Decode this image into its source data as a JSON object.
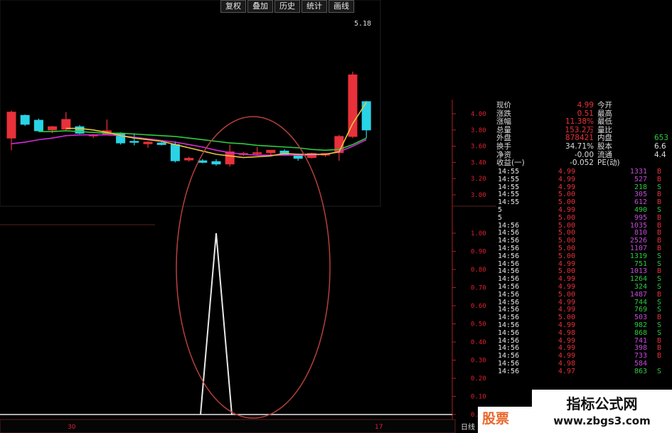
{
  "toolbar": {
    "buttons": [
      "复权",
      "叠加",
      "历史",
      "统计",
      "画线"
    ]
  },
  "price_top": "5.18",
  "price_axis": [
    "4.00",
    "3.80",
    "3.60",
    "3.40",
    "3.20",
    "3.00"
  ],
  "indicator_axis": [
    "1.00",
    "0.90",
    "0.80",
    "0.70",
    "0.60",
    "0.50",
    "0.40",
    "0.30",
    "0.20",
    "0.10",
    "0.00"
  ],
  "bottom_labels": {
    "left": "30",
    "right": "17",
    "corner": "日线"
  },
  "colors": {
    "up": "#e8313a",
    "down": "#29d3e6",
    "ma_green": "#2ecc40",
    "ma_magenta": "#d52bd8",
    "ma_yellow": "#e6c640",
    "ellipse": "#b5403a"
  },
  "quote": [
    {
      "label": "现价",
      "value": "4.99",
      "label2": "今开",
      "value2": ""
    },
    {
      "label": "涨跌",
      "value": "0.51",
      "label2": "最高",
      "value2": ""
    },
    {
      "label": "涨幅",
      "value": "11.38%",
      "label2": "最低",
      "value2": ""
    },
    {
      "label": "总量",
      "value": "153.2万",
      "label2": "量比",
      "value2": ""
    },
    {
      "label": "外盘",
      "value": "878421",
      "label2": "内盘",
      "value2": "653"
    },
    {
      "label": "换手",
      "value": "34.71%",
      "label2": "股本",
      "value2": "6.6"
    },
    {
      "label": "净资",
      "value": "-0.00",
      "label2": "流通",
      "value2": "4.4"
    },
    {
      "label": "收益(一)",
      "value": "-0.052",
      "label2": "PE(动)",
      "value2": ""
    }
  ],
  "trades": [
    [
      "14:55",
      "4.99",
      "1331",
      "B"
    ],
    [
      "14:55",
      "4.99",
      "527",
      "B"
    ],
    [
      "14:55",
      "4.99",
      "218",
      "S"
    ],
    [
      "14:55",
      "5.00",
      "305",
      "B"
    ],
    [
      "14:55",
      "5.00",
      "612",
      "B"
    ],
    [
      "5",
      "4.99",
      "490",
      "S"
    ],
    [
      "5",
      "5.00",
      "995",
      "B"
    ],
    [
      "14:56",
      "5.00",
      "1035",
      "B"
    ],
    [
      "14:56",
      "5.00",
      "810",
      "B"
    ],
    [
      "14:56",
      "5.00",
      "2526",
      "B"
    ],
    [
      "14:56",
      "5.00",
      "1107",
      "B"
    ],
    [
      "14:56",
      "5.00",
      "1319",
      "S"
    ],
    [
      "14:56",
      "4.99",
      "751",
      "S"
    ],
    [
      "14:56",
      "5.00",
      "1013",
      "B"
    ],
    [
      "14:56",
      "4.99",
      "1264",
      "S"
    ],
    [
      "14:56",
      "4.99",
      "324",
      "S"
    ],
    [
      "14:56",
      "5.00",
      "1487",
      "B"
    ],
    [
      "14:56",
      "4.99",
      "744",
      "S"
    ],
    [
      "14:56",
      "4.99",
      "769",
      "S"
    ],
    [
      "14:56",
      "5.00",
      "503",
      "B"
    ],
    [
      "14:56",
      "4.99",
      "982",
      "S"
    ],
    [
      "14:56",
      "4.98",
      "868",
      "S"
    ],
    [
      "14:56",
      "4.99",
      "741",
      "B"
    ],
    [
      "14:56",
      "4.99",
      "398",
      "B"
    ],
    [
      "14:56",
      "4.99",
      "733",
      "B"
    ],
    [
      "14:56",
      "4.98",
      "584",
      ""
    ],
    [
      "14:56",
      "4.97",
      "863",
      "S"
    ]
  ],
  "watermark": {
    "line1": "指标公式网",
    "line2": "www.zbgs3.com",
    "logo": "股票"
  },
  "chart_data": [
    {
      "type": "candlestick",
      "candles": [
        {
          "o": 3.7,
          "h": 4.04,
          "l": 3.55,
          "c": 4.02
        },
        {
          "o": 3.98,
          "h": 3.99,
          "l": 3.85,
          "c": 3.87
        },
        {
          "o": 3.92,
          "h": 3.94,
          "l": 3.78,
          "c": 3.79
        },
        {
          "o": 3.8,
          "h": 3.85,
          "l": 3.76,
          "c": 3.84
        },
        {
          "o": 3.81,
          "h": 4.02,
          "l": 3.79,
          "c": 3.93
        },
        {
          "o": 3.84,
          "h": 3.86,
          "l": 3.75,
          "c": 3.76
        },
        {
          "o": 3.73,
          "h": 3.75,
          "l": 3.7,
          "c": 3.74
        },
        {
          "o": 3.75,
          "h": 3.93,
          "l": 3.74,
          "c": 3.79
        },
        {
          "o": 3.75,
          "h": 3.77,
          "l": 3.62,
          "c": 3.64
        },
        {
          "o": 3.66,
          "h": 3.76,
          "l": 3.61,
          "c": 3.65
        },
        {
          "o": 3.63,
          "h": 3.66,
          "l": 3.58,
          "c": 3.65
        },
        {
          "o": 3.64,
          "h": 3.65,
          "l": 3.61,
          "c": 3.62
        },
        {
          "o": 3.62,
          "h": 3.66,
          "l": 3.4,
          "c": 3.42
        },
        {
          "o": 3.43,
          "h": 3.47,
          "l": 3.41,
          "c": 3.45
        },
        {
          "o": 3.42,
          "h": 3.44,
          "l": 3.39,
          "c": 3.4
        },
        {
          "o": 3.41,
          "h": 3.44,
          "l": 3.36,
          "c": 3.38
        },
        {
          "o": 3.38,
          "h": 3.62,
          "l": 3.35,
          "c": 3.53
        },
        {
          "o": 3.5,
          "h": 3.53,
          "l": 3.48,
          "c": 3.51
        },
        {
          "o": 3.51,
          "h": 3.59,
          "l": 3.49,
          "c": 3.52
        },
        {
          "o": 3.52,
          "h": 3.55,
          "l": 3.49,
          "c": 3.55
        },
        {
          "o": 3.54,
          "h": 3.56,
          "l": 3.48,
          "c": 3.49
        },
        {
          "o": 3.49,
          "h": 3.51,
          "l": 3.42,
          "c": 3.45
        },
        {
          "o": 3.46,
          "h": 3.52,
          "l": 3.45,
          "c": 3.51
        },
        {
          "o": 3.49,
          "h": 3.51,
          "l": 3.47,
          "c": 3.51
        },
        {
          "o": 3.52,
          "h": 3.74,
          "l": 3.42,
          "c": 3.72
        },
        {
          "o": 3.72,
          "h": 4.52,
          "l": 3.7,
          "c": 4.48
        },
        {
          "o": 4.15,
          "h": 4.16,
          "l": 3.7,
          "c": 3.8
        }
      ],
      "ma": [
        {
          "color": "ma_green",
          "values": [
            null,
            null,
            3.78,
            3.78,
            3.79,
            3.78,
            3.77,
            3.76,
            3.76,
            3.75,
            3.74,
            3.73,
            3.72,
            3.7,
            3.68,
            3.66,
            3.64,
            3.63,
            3.61,
            3.6,
            3.59,
            3.58,
            3.56,
            3.55,
            3.56,
            3.62,
            3.7
          ]
        },
        {
          "color": "ma_magenta",
          "values": [
            3.63,
            3.65,
            3.68,
            3.7,
            3.73,
            3.74,
            3.74,
            3.74,
            3.73,
            3.71,
            3.69,
            3.67,
            3.65,
            3.62,
            3.59,
            3.55,
            3.52,
            3.5,
            3.49,
            3.49,
            3.49,
            3.49,
            3.49,
            3.5,
            3.53,
            3.6,
            3.68
          ]
        },
        {
          "color": "ma_yellow",
          "values": [
            null,
            null,
            null,
            null,
            3.82,
            3.82,
            3.8,
            3.77,
            3.73,
            3.7,
            3.68,
            3.66,
            3.62,
            3.58,
            3.54,
            3.5,
            3.48,
            3.46,
            3.47,
            3.48,
            3.51,
            3.5,
            3.5,
            3.5,
            3.53,
            3.88,
            4.14
          ]
        }
      ]
    },
    {
      "type": "line",
      "series": [
        {
          "values": [
            0,
            0,
            0,
            0,
            0,
            0,
            0,
            0,
            0,
            0,
            0,
            0,
            0,
            0,
            0,
            1,
            0,
            0,
            0,
            0,
            0,
            0,
            0,
            0,
            0,
            0,
            0
          ]
        }
      ],
      "ylim": [
        0,
        1
      ]
    }
  ]
}
